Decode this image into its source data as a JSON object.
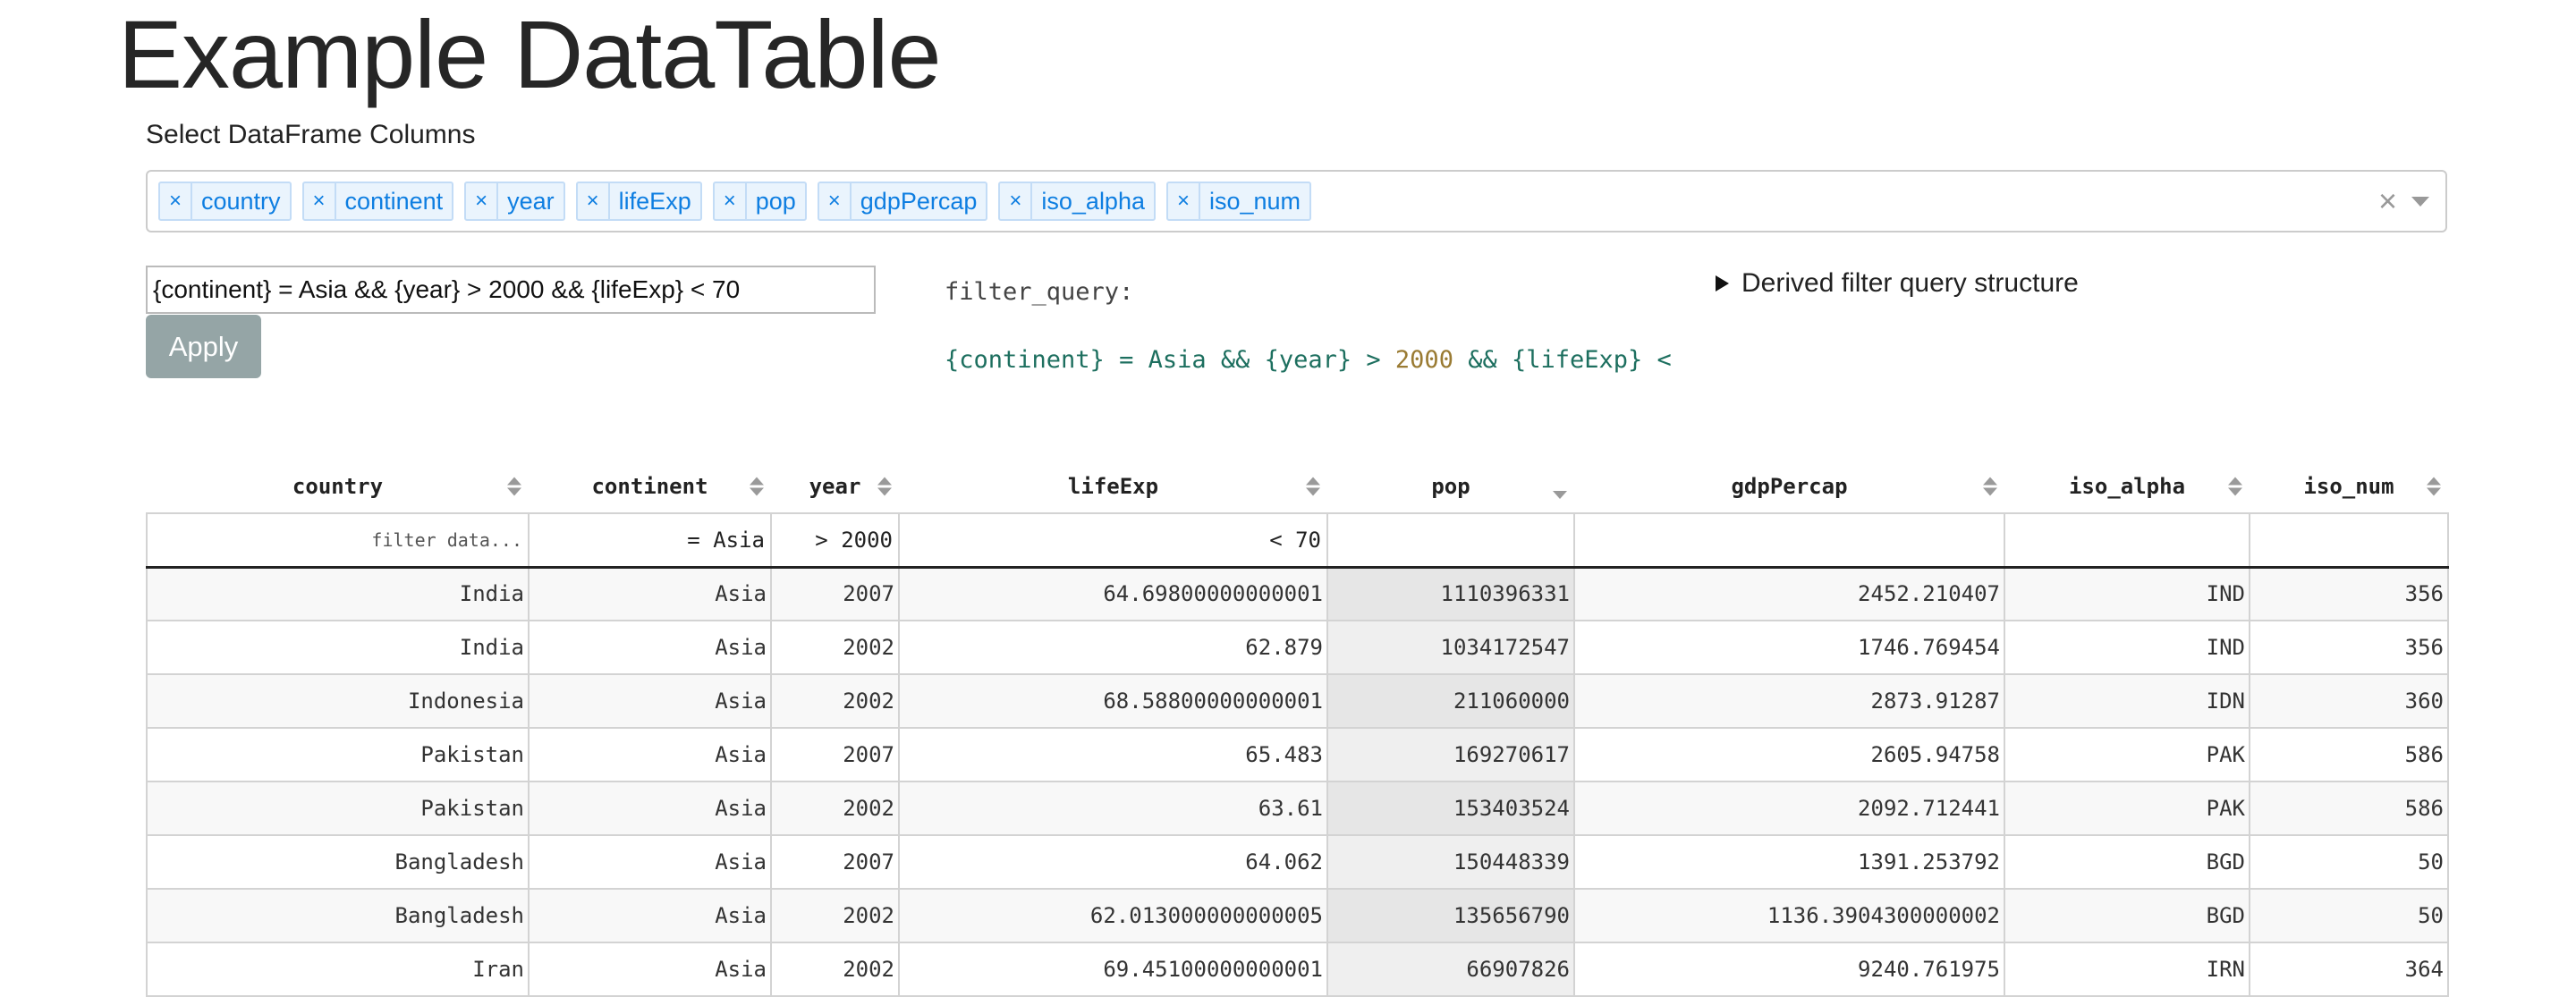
{
  "page": {
    "title": "Example DataTable"
  },
  "column_select": {
    "label": "Select DataFrame Columns",
    "chips": [
      "country",
      "continent",
      "year",
      "lifeExp",
      "pop",
      "gdpPercap",
      "iso_alpha",
      "iso_num"
    ],
    "remove_glyph": "×",
    "clear_glyph": "×"
  },
  "query": {
    "input_value": "{continent} = Asia && {year} > 2000 && {lifeExp} < 70",
    "apply_label": "Apply",
    "filter_query_label": "filter_query:",
    "code_part1": "{continent} = Asia && {year} > ",
    "code_num": "2000",
    "code_part2": " && {lifeExp} <",
    "derived_label": "Derived filter query structure"
  },
  "table": {
    "columns": [
      {
        "key": "country",
        "label": "country"
      },
      {
        "key": "continent",
        "label": "continent"
      },
      {
        "key": "year",
        "label": "year"
      },
      {
        "key": "lifeExp",
        "label": "lifeExp"
      },
      {
        "key": "pop",
        "label": "pop"
      },
      {
        "key": "gdpPercap",
        "label": "gdpPercap"
      },
      {
        "key": "iso_alpha",
        "label": "iso_alpha"
      },
      {
        "key": "iso_num",
        "label": "iso_num"
      }
    ],
    "filters": {
      "country": "filter data...",
      "continent": "= Asia",
      "year": "> 2000",
      "lifeExp": "< 70",
      "pop": "",
      "gdpPercap": "",
      "iso_alpha": "",
      "iso_num": ""
    },
    "rows": [
      [
        "India",
        "Asia",
        "2007",
        "64.69800000000001",
        "1110396331",
        "2452.210407",
        "IND",
        "356"
      ],
      [
        "India",
        "Asia",
        "2002",
        "62.879",
        "1034172547",
        "1746.769454",
        "IND",
        "356"
      ],
      [
        "Indonesia",
        "Asia",
        "2002",
        "68.58800000000001",
        "211060000",
        "2873.91287",
        "IDN",
        "360"
      ],
      [
        "Pakistan",
        "Asia",
        "2007",
        "65.483",
        "169270617",
        "2605.94758",
        "PAK",
        "586"
      ],
      [
        "Pakistan",
        "Asia",
        "2002",
        "63.61",
        "153403524",
        "2092.712441",
        "PAK",
        "586"
      ],
      [
        "Bangladesh",
        "Asia",
        "2007",
        "64.062",
        "150448339",
        "1391.253792",
        "BGD",
        "50"
      ],
      [
        "Bangladesh",
        "Asia",
        "2002",
        "62.013000000000005",
        "135656790",
        "1136.3904300000002",
        "BGD",
        "50"
      ],
      [
        "Iran",
        "Asia",
        "2002",
        "69.45100000000001",
        "66907826",
        "9240.761975",
        "IRN",
        "364"
      ]
    ]
  }
}
